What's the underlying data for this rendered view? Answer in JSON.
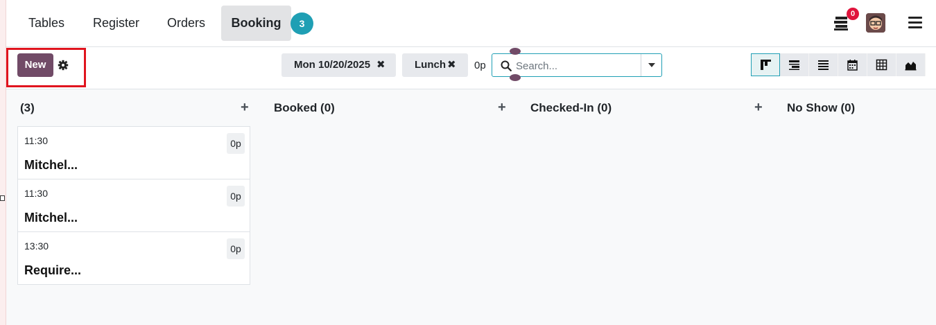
{
  "nav": {
    "items": [
      {
        "label": "Tables"
      },
      {
        "label": "Register"
      },
      {
        "label": "Orders"
      },
      {
        "label": "Booking"
      }
    ],
    "badge": "3",
    "notification_count": "0"
  },
  "toolbar": {
    "new_label": "New",
    "facets": [
      {
        "label": "Mon 10/20/2025"
      },
      {
        "label": "Lunch"
      }
    ],
    "covers": "0p",
    "search_placeholder": "Search..."
  },
  "views": [
    "kanban-view-icon",
    "gantt-view-icon",
    "list-view-icon",
    "calendar-view-icon",
    "pivot-view-icon",
    "graph-view-icon"
  ],
  "columns": [
    {
      "title": "(3)"
    },
    {
      "title": "Booked (0)"
    },
    {
      "title": "Checked-In (0)"
    },
    {
      "title": "No Show (0)"
    }
  ],
  "cards": [
    {
      "time": "11:30",
      "title": "Mitchel...",
      "covers": "0p"
    },
    {
      "time": "11:30",
      "title": "Mitchel...",
      "covers": "0p"
    },
    {
      "time": "13:30",
      "title": "Require...",
      "covers": "0p"
    }
  ],
  "colors": {
    "brand": "#714b67",
    "accent": "#1f9fb4",
    "highlight": "#e0141e",
    "notification": "#e0143c"
  }
}
